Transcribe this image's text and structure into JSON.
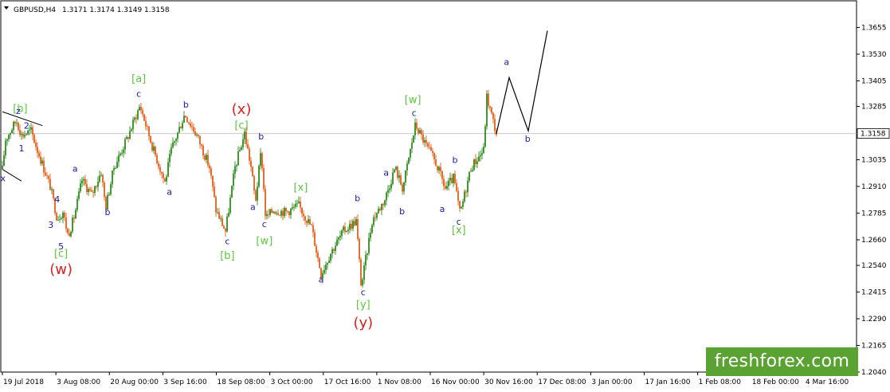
{
  "header": {
    "symbol": "GBPUSD,H4",
    "ohlc": "1.3171 1.3174 1.3149 1.3158"
  },
  "watermark": "freshforex.com",
  "chart_data": {
    "type": "candlestick",
    "symbol": "GBPUSD",
    "timeframe": "H4",
    "current_price": 1.3158,
    "current_price_label": "1.3158",
    "ylim": [
      1.204,
      1.378
    ],
    "y_ticks": [
      "1.3655",
      "1.3530",
      "1.3405",
      "1.3285",
      "1.3035",
      "1.2910",
      "1.2785",
      "1.2660",
      "1.2540",
      "1.2415",
      "1.2290",
      "1.2165",
      "1.2040"
    ],
    "x_ticks": [
      "19 Jul 2018",
      "3 Aug 08:00",
      "20 Aug 00:00",
      "3 Sep 16:00",
      "18 Sep 08:00",
      "3 Oct 00:00",
      "17 Oct 16:00",
      "1 Nov 08:00",
      "16 Nov 00:00",
      "30 Nov 16:00",
      "17 Dec 08:00",
      "3 Jan 00:00",
      "17 Jan 16:00",
      "1 Feb 08:00",
      "18 Feb 00:00",
      "4 Mar 16:00"
    ],
    "price_path": [
      {
        "t": 0,
        "p": 1.299
      },
      {
        "t": 0.5,
        "p": 1.313
      },
      {
        "t": 2.2,
        "p": 1.322
      },
      {
        "t": 3.0,
        "p": 1.315
      },
      {
        "t": 4.5,
        "p": 1.317
      },
      {
        "t": 5.5,
        "p": 1.308
      },
      {
        "t": 7.5,
        "p": 1.291
      },
      {
        "t": 8.6,
        "p": 1.276
      },
      {
        "t": 9.5,
        "p": 1.279
      },
      {
        "t": 10.3,
        "p": 1.268
      },
      {
        "t": 11.2,
        "p": 1.276
      },
      {
        "t": 12.5,
        "p": 1.294
      },
      {
        "t": 14.0,
        "p": 1.287
      },
      {
        "t": 15.5,
        "p": 1.298
      },
      {
        "t": 16.2,
        "p": 1.281
      },
      {
        "t": 17.5,
        "p": 1.3
      },
      {
        "t": 19.5,
        "p": 1.313
      },
      {
        "t": 21.6,
        "p": 1.329
      },
      {
        "t": 23.5,
        "p": 1.31
      },
      {
        "t": 25.5,
        "p": 1.293
      },
      {
        "t": 26.5,
        "p": 1.308
      },
      {
        "t": 28.6,
        "p": 1.325
      },
      {
        "t": 30.5,
        "p": 1.315
      },
      {
        "t": 32.5,
        "p": 1.3
      },
      {
        "t": 33.5,
        "p": 1.28
      },
      {
        "t": 35.0,
        "p": 1.27
      },
      {
        "t": 36.5,
        "p": 1.3
      },
      {
        "t": 38.0,
        "p": 1.316
      },
      {
        "t": 39.0,
        "p": 1.3
      },
      {
        "t": 39.7,
        "p": 1.284
      },
      {
        "t": 40.6,
        "p": 1.308
      },
      {
        "t": 41.3,
        "p": 1.276
      },
      {
        "t": 42.5,
        "p": 1.28
      },
      {
        "t": 44.5,
        "p": 1.279
      },
      {
        "t": 46.5,
        "p": 1.282
      },
      {
        "t": 48.5,
        "p": 1.272
      },
      {
        "t": 50.0,
        "p": 1.25
      },
      {
        "t": 51.5,
        "p": 1.26
      },
      {
        "t": 53.5,
        "p": 1.27
      },
      {
        "t": 55.5,
        "p": 1.275
      },
      {
        "t": 56.3,
        "p": 1.244
      },
      {
        "t": 58.0,
        "p": 1.275
      },
      {
        "t": 60.0,
        "p": 1.285
      },
      {
        "t": 61.6,
        "p": 1.3
      },
      {
        "t": 62.8,
        "p": 1.29
      },
      {
        "t": 64.8,
        "p": 1.32
      },
      {
        "t": 66.5,
        "p": 1.31
      },
      {
        "t": 68.0,
        "p": 1.302
      },
      {
        "t": 69.5,
        "p": 1.29
      },
      {
        "t": 70.8,
        "p": 1.295
      },
      {
        "t": 71.8,
        "p": 1.278
      },
      {
        "t": 73.5,
        "p": 1.3
      },
      {
        "t": 75.5,
        "p": 1.308
      },
      {
        "t": 76.0,
        "p": 1.333
      },
      {
        "t": 77.5,
        "p": 1.3158
      }
    ],
    "projection": [
      {
        "t": 77.5,
        "p": 1.3158
      },
      {
        "t": 79.5,
        "p": 1.342
      },
      {
        "t": 82.5,
        "p": 1.317
      },
      {
        "t": 85.5,
        "p": 1.364
      }
    ],
    "channel_lines": [
      {
        "t1": 0,
        "p1": 1.326,
        "t2": 6.3,
        "p2": 1.3195
      },
      {
        "t1": 0,
        "p1": 1.299,
        "t2": 3.0,
        "p2": 1.2935
      }
    ],
    "wave_labels": [
      {
        "text": "x",
        "t": 0.1,
        "p": 1.2935,
        "kind": "minor"
      },
      {
        "text": "[b]",
        "t": 2.8,
        "p": 1.326,
        "kind": "intermediate"
      },
      {
        "text": "z",
        "t": 2.5,
        "p": 1.325,
        "kind": "minor"
      },
      {
        "text": "2",
        "t": 3.8,
        "p": 1.318,
        "kind": "minor"
      },
      {
        "text": "1",
        "t": 3.0,
        "p": 1.3075,
        "kind": "minor"
      },
      {
        "text": "4",
        "t": 8.6,
        "p": 1.2835,
        "kind": "minor"
      },
      {
        "text": "3",
        "t": 7.6,
        "p": 1.2715,
        "kind": "minor"
      },
      {
        "text": "5",
        "t": 9.2,
        "p": 1.2615,
        "kind": "minor"
      },
      {
        "text": "[c]",
        "t": 9.2,
        "p": 1.258,
        "kind": "intermediate"
      },
      {
        "text": "(w)",
        "t": 9.2,
        "p": 1.25,
        "kind": "primary"
      },
      {
        "text": "a",
        "t": 11.4,
        "p": 1.298,
        "kind": "minor"
      },
      {
        "text": "b",
        "t": 16.5,
        "p": 1.2775,
        "kind": "minor"
      },
      {
        "text": "[a]",
        "t": 21.4,
        "p": 1.34,
        "kind": "intermediate"
      },
      {
        "text": "c",
        "t": 21.4,
        "p": 1.333,
        "kind": "minor"
      },
      {
        "text": "a",
        "t": 26.2,
        "p": 1.287,
        "kind": "minor"
      },
      {
        "text": "b",
        "t": 28.8,
        "p": 1.328,
        "kind": "minor"
      },
      {
        "text": "(x)",
        "t": 37.5,
        "p": 1.325,
        "kind": "primary"
      },
      {
        "text": "[c]",
        "t": 37.5,
        "p": 1.318,
        "kind": "intermediate"
      },
      {
        "text": "c",
        "t": 35.3,
        "p": 1.264,
        "kind": "minor"
      },
      {
        "text": "[b]",
        "t": 35.3,
        "p": 1.257,
        "kind": "intermediate"
      },
      {
        "text": "a",
        "t": 39.3,
        "p": 1.28,
        "kind": "minor"
      },
      {
        "text": "b",
        "t": 40.6,
        "p": 1.313,
        "kind": "minor"
      },
      {
        "text": "c",
        "t": 41.1,
        "p": 1.272,
        "kind": "minor"
      },
      {
        "text": "[w]",
        "t": 41.1,
        "p": 1.264,
        "kind": "intermediate"
      },
      {
        "text": "[x]",
        "t": 46.8,
        "p": 1.289,
        "kind": "intermediate"
      },
      {
        "text": "a",
        "t": 50.0,
        "p": 1.246,
        "kind": "minor"
      },
      {
        "text": "b",
        "t": 55.7,
        "p": 1.284,
        "kind": "minor"
      },
      {
        "text": "c",
        "t": 56.6,
        "p": 1.24,
        "kind": "minor"
      },
      {
        "text": "[y]",
        "t": 56.6,
        "p": 1.234,
        "kind": "intermediate"
      },
      {
        "text": "(y)",
        "t": 56.6,
        "p": 1.225,
        "kind": "primary"
      },
      {
        "text": "a",
        "t": 60.2,
        "p": 1.296,
        "kind": "minor"
      },
      {
        "text": "b",
        "t": 62.7,
        "p": 1.278,
        "kind": "minor"
      },
      {
        "text": "[w]",
        "t": 64.4,
        "p": 1.33,
        "kind": "intermediate"
      },
      {
        "text": "c",
        "t": 64.6,
        "p": 1.324,
        "kind": "minor"
      },
      {
        "text": "a",
        "t": 69.0,
        "p": 1.279,
        "kind": "minor"
      },
      {
        "text": "b",
        "t": 71.0,
        "p": 1.302,
        "kind": "minor"
      },
      {
        "text": "c",
        "t": 71.6,
        "p": 1.273,
        "kind": "minor"
      },
      {
        "text": "[x]",
        "t": 71.6,
        "p": 1.269,
        "kind": "intermediate"
      },
      {
        "text": "a",
        "t": 79.1,
        "p": 1.348,
        "kind": "minor"
      },
      {
        "text": "b",
        "t": 82.4,
        "p": 1.312,
        "kind": "minor"
      }
    ],
    "colors": {
      "bull": "#2e8b1e",
      "bear": "#e0601a",
      "axis": "#000000",
      "minor_label": "#1a1aa8",
      "intermediate_label": "#5ac83c",
      "primary_label": "#e02020",
      "projection": "#000000",
      "price_line": "#c8c8c8"
    }
  }
}
